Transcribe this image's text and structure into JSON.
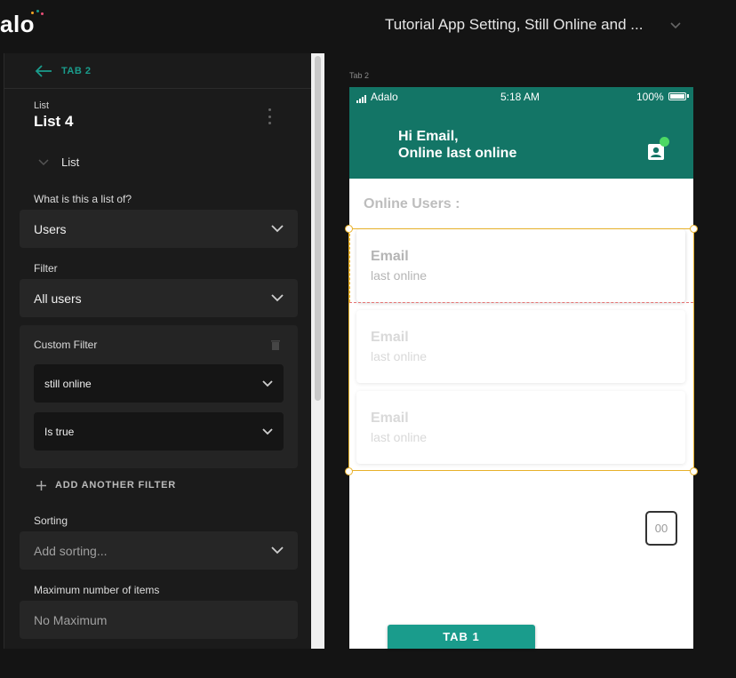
{
  "brand": {
    "logo_text": "alo"
  },
  "app_title": "Tutorial App Setting, Still Online and ...",
  "panel": {
    "back_label": "TAB 2",
    "component_type": "List",
    "component_name": "List 4",
    "section_label": "List",
    "list_of": {
      "label": "What is this a list of?",
      "value": "Users"
    },
    "filter": {
      "label": "Filter",
      "value": "All users"
    },
    "custom_filter": {
      "title": "Custom Filter",
      "property": "still online",
      "condition": "Is true"
    },
    "add_filter_label": "ADD ANOTHER FILTER",
    "sorting": {
      "label": "Sorting",
      "placeholder": "Add sorting..."
    },
    "max_items": {
      "label": "Maximum number of items",
      "placeholder": "No Maximum"
    }
  },
  "preview": {
    "screen_label": "Tab 2",
    "status": {
      "carrier": "Adalo",
      "time": "5:18 AM",
      "battery": "100%"
    },
    "header": {
      "greeting_line1": "Hi Email,",
      "greeting_line2": "Online last online"
    },
    "section_title": "Online Users :",
    "cards": [
      {
        "email": "Email",
        "subtitle": "last online"
      },
      {
        "email": "Email",
        "subtitle": "last online"
      },
      {
        "email": "Email",
        "subtitle": "last online"
      }
    ],
    "counter_value": "00",
    "tab_button": "TAB 1"
  },
  "colors": {
    "accent": "#1a9c8c",
    "header": "#137566",
    "selection": "#e8b12a",
    "online": "#4cd964"
  }
}
